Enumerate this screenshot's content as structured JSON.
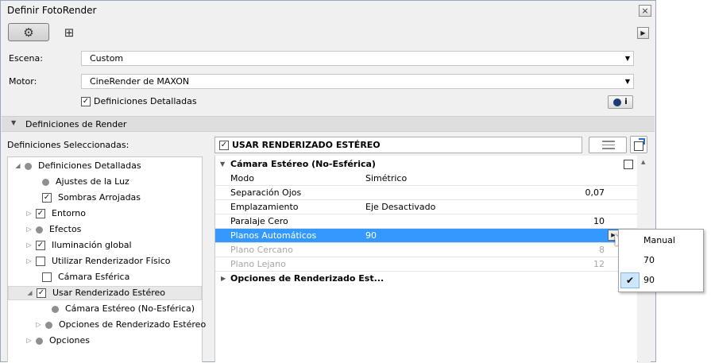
{
  "window": {
    "title": "Definir FotoRender",
    "close_label": "×"
  },
  "toolbar": {
    "settings_icon": "⚙",
    "grid_icon": "⊞",
    "arrow_icon": "▶"
  },
  "scene": {
    "label": "Escena:",
    "value": "Custom"
  },
  "engine": {
    "label": "Motor:",
    "value": "CineRender de MAXON"
  },
  "detailed": {
    "label": "Definiciones Detalladas",
    "checked": true,
    "info_label": "i"
  },
  "render_section": {
    "label": "Definiciones de Render"
  },
  "selected_label": "Definiciones Seleccionadas:",
  "tree": [
    {
      "label": "Definiciones Detalladas",
      "kind": "dot",
      "expanded": true
    },
    {
      "label": "Ajustes de la Luz",
      "kind": "dot"
    },
    {
      "label": "Sombras Arrojadas",
      "kind": "check",
      "checked": true
    },
    {
      "label": "Entorno",
      "kind": "check",
      "checked": true,
      "collapsed": true
    },
    {
      "label": "Efectos",
      "kind": "dot",
      "collapsed": true
    },
    {
      "label": "Iluminación global",
      "kind": "check",
      "checked": true,
      "collapsed": true
    },
    {
      "label": "Utilizar Renderizador Físico",
      "kind": "check",
      "checked": false,
      "collapsed": true
    },
    {
      "label": "Cámara Esférica",
      "kind": "check",
      "checked": false
    },
    {
      "label": "Usar Renderizado Estéreo",
      "kind": "check",
      "checked": true,
      "expanded": true,
      "selected": true
    },
    {
      "label": "Cámara Estéreo (No-Esférica)",
      "kind": "dot"
    },
    {
      "label": "Opciones de Renderizado Estéreo",
      "kind": "dot",
      "collapsed": true
    },
    {
      "label": "Opciones",
      "kind": "dot",
      "collapsed": true
    }
  ],
  "right_header": {
    "label": "USAR RENDERIZADO ESTÉREO",
    "checked": true
  },
  "group1": {
    "label": "Cámara Estéreo (No-Esférica)"
  },
  "props": [
    {
      "name": "Modo",
      "value": "Simétrico",
      "num": ""
    },
    {
      "name": "Separación Ojos",
      "value": "",
      "num": "0,07"
    },
    {
      "name": "Emplazamiento",
      "value": "Eje Desactivado",
      "num": ""
    },
    {
      "name": "Paralaje Cero",
      "value": "",
      "num": "10"
    },
    {
      "name": "Planos Automáticos",
      "value": "90",
      "num": ""
    },
    {
      "name": "Plano Cercano",
      "value": "",
      "num": "8"
    },
    {
      "name": "Plano Lejano",
      "value": "",
      "num": "12"
    }
  ],
  "group2": {
    "label": "Opciones de Renderizado Est..."
  },
  "popup": {
    "items": [
      "Manual",
      "70",
      "90"
    ],
    "selected": "90",
    "check_mark": "✔"
  },
  "colors": {
    "highlight": "#3399ff",
    "selected_check_bg": "#cde6fb"
  }
}
